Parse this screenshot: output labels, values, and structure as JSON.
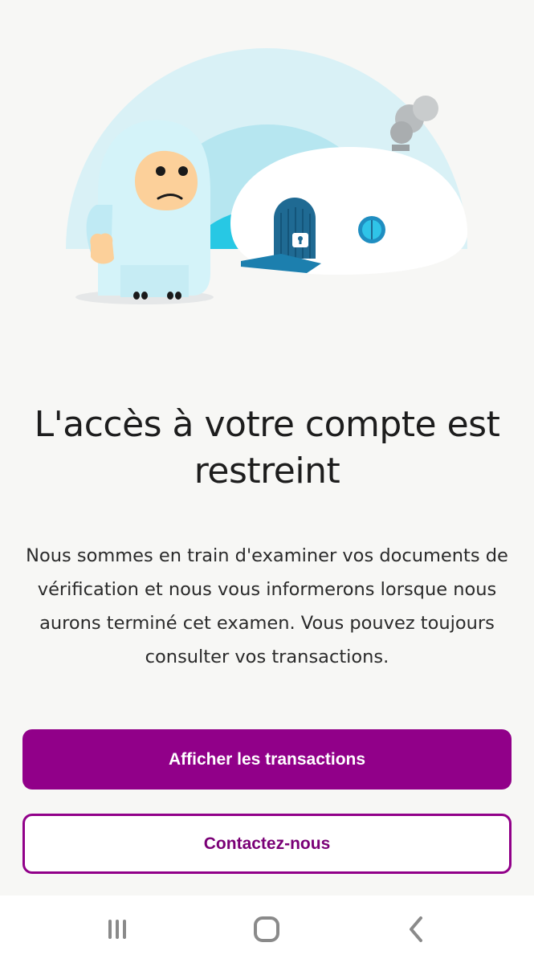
{
  "main": {
    "title": "L'accès à votre compte est restreint",
    "description": "Nous sommes en train d'examiner vos documents de vérification et nous vous informerons lorsque nous aurons terminé cet examen. Vous pouvez toujours consulter vos transactions.",
    "primary_button": "Afficher les transactions",
    "secondary_button": "Contactez-nous"
  },
  "illustration": {
    "subject": "yeti beside igloo with locked door"
  },
  "nav": {
    "recent_icon": "recent-apps-icon",
    "home_icon": "home-icon",
    "back_icon": "back-icon"
  },
  "colors": {
    "brand": "#910089",
    "background": "#f7f7f5"
  }
}
